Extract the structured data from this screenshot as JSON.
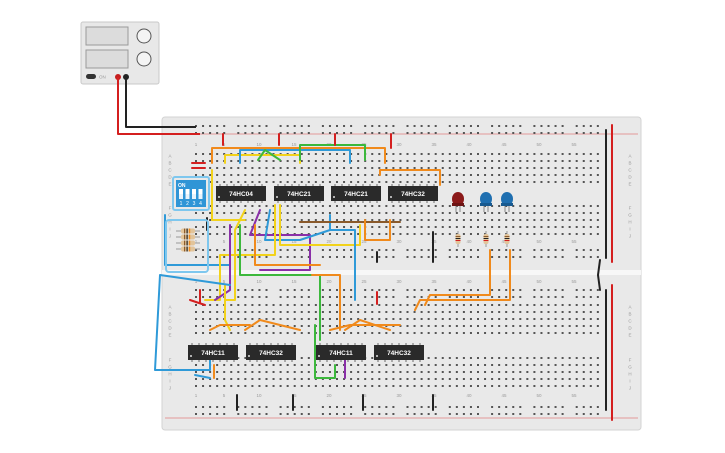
{
  "power_supply": {
    "switch_label": "ON"
  },
  "dip_switch": {
    "on_label": "ON",
    "numbers": [
      "1",
      "2",
      "3",
      "4"
    ]
  },
  "chips": [
    {
      "label": "74HC04"
    },
    {
      "label": "74HC21"
    },
    {
      "label": "74HC21"
    },
    {
      "label": "74HC32"
    },
    {
      "label": "74HC11"
    },
    {
      "label": "74HC32"
    },
    {
      "label": "74HC11"
    },
    {
      "label": "74HC32"
    }
  ],
  "column_numbers": [
    "1",
    "5",
    "10",
    "15",
    "20",
    "25",
    "30",
    "35",
    "40",
    "45",
    "50",
    "55"
  ],
  "row_letters_top": [
    "A",
    "B",
    "C",
    "D",
    "E",
    "F",
    "G",
    "H",
    "I",
    "J"
  ],
  "colors": {
    "breadboard": "#e9e9e9",
    "wire_red": "#d41f1f",
    "wire_black": "#222222",
    "wire_orange": "#f08a1c",
    "wire_yellow": "#f2d21b",
    "wire_blue": "#2f9ad8",
    "wire_green": "#3cb83c",
    "wire_purple": "#8a2fa8",
    "wire_brown": "#8a5a2b",
    "led_red": "#8b1a1a",
    "led_blue": "#1f6fb0",
    "dip_body": "#2f95d6",
    "chip_body": "#2a2a2a"
  }
}
